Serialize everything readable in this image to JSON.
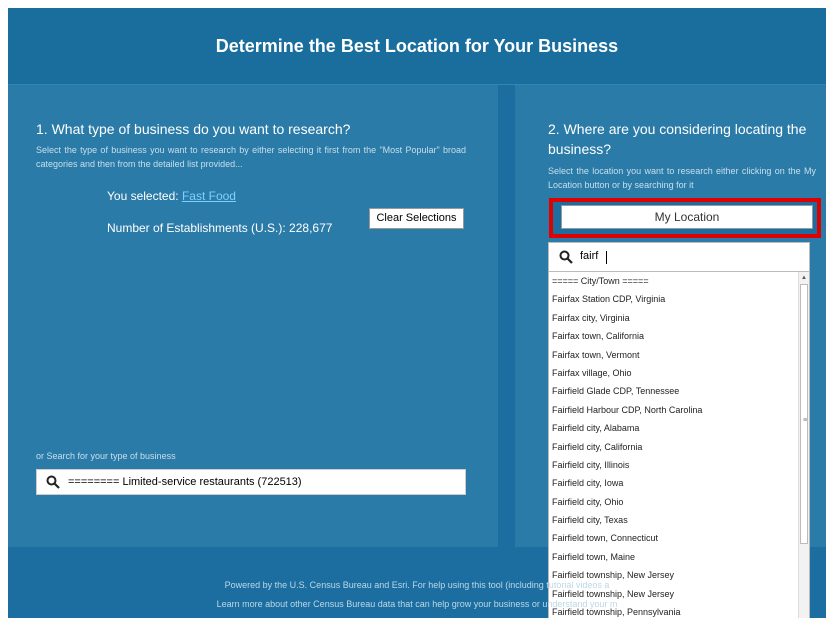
{
  "header": {
    "title": "Determine the Best Location for Your Business"
  },
  "left_panel": {
    "question": "1. What type of business do you want to research?",
    "description": "Select the type of business you want to research by either selecting it first from the \"Most Popular\" broad categories and then from the detailed list provided...",
    "selected_prefix": "You selected: ",
    "selected_value": "Fast Food",
    "establishments": "Number of Establishments (U.S.): 228,677",
    "clear_button": "Clear Selections",
    "search_label": "or Search for your type of business",
    "search_value": "======== Limited-service restaurants (722513)"
  },
  "right_panel": {
    "question": "2. Where are you considering locating the business?",
    "description": "Select the location you want to research either clicking on the My Location button or by searching for it",
    "my_location_button": "My Location",
    "search_value": "fairf"
  },
  "dropdown": {
    "items": [
      "===== City/Town =====",
      "Fairfax Station CDP, Virginia",
      "Fairfax city, Virginia",
      "Fairfax town, California",
      "Fairfax town, Vermont",
      "Fairfax village, Ohio",
      "Fairfield Glade CDP, Tennessee",
      "Fairfield Harbour CDP, North Carolina",
      "Fairfield city, Alabama",
      "Fairfield city, California",
      "Fairfield city, Illinois",
      "Fairfield city, Iowa",
      "Fairfield city, Ohio",
      "Fairfield city, Texas",
      "Fairfield town, Connecticut",
      "Fairfield town, Maine",
      "Fairfield township, New Jersey",
      "Fairfield township, New Jersey",
      "Fairfield township, Pennsylvania"
    ]
  },
  "footer": {
    "line1": "Powered by the U.S. Census Bureau and Esri. For help using this tool (including tutorial videos a",
    "line2": "Learn more about other Census Bureau data that can help grow your business or understand your m"
  },
  "colors": {
    "background": "#1b6e9f",
    "panel": "#2b7ba8",
    "highlight_border": "#e00000",
    "link": "#7fd0ff"
  }
}
